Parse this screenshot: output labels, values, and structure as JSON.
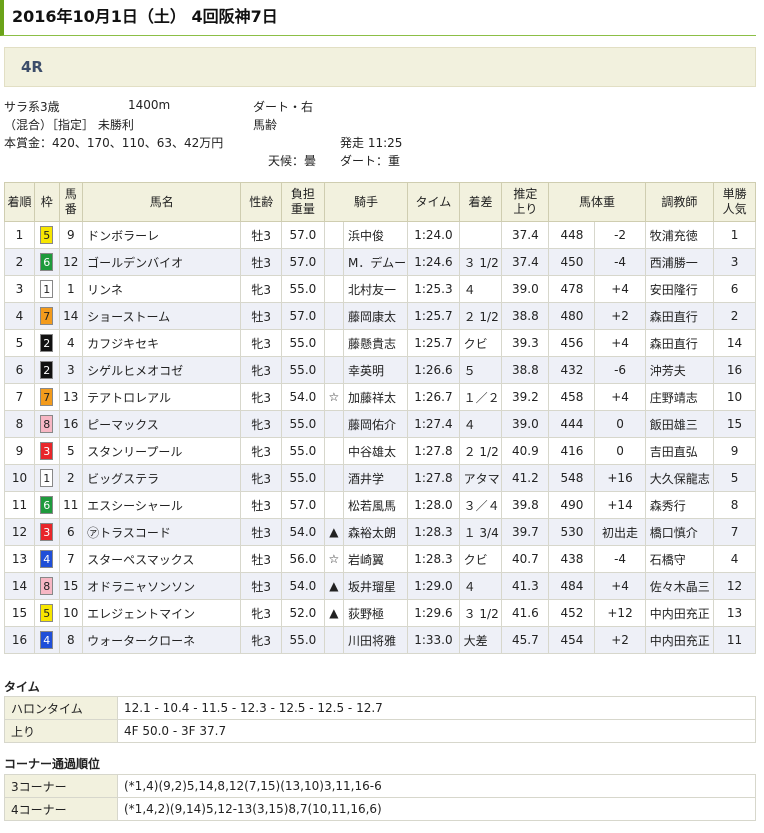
{
  "header": {
    "title": "2016年10月1日（土） 4回阪神7日"
  },
  "race": {
    "name": "4R"
  },
  "conditions": {
    "class": "サラ系3歳",
    "distance": "1400m",
    "track": "ダート・右",
    "type": "（混合）［指定］ 未勝利",
    "weight_rule": "馬齢",
    "prize": "本賞金：420、170、110、63、42万円",
    "start": "発走 11:25",
    "weather": "天候：曇",
    "going": "ダート：重"
  },
  "table": {
    "headers": [
      "着順",
      "枠",
      "馬番",
      "馬名",
      "性齢",
      "負担重量",
      "騎手",
      "タイム",
      "着差",
      "推定上り",
      "馬体重",
      "",
      "調教師",
      "単勝人気"
    ],
    "rows": [
      {
        "pos": "1",
        "waku": "5",
        "num": "9",
        "horse": "ドンボラーレ",
        "sex": "牡3",
        "wt": "57.0",
        "mark": "",
        "jockey": "浜中俊",
        "time": "1:24.0",
        "margin": "",
        "last": "37.4",
        "bw": "448",
        "diff": "-2",
        "trainer": "牧浦充徳",
        "pop": "1"
      },
      {
        "pos": "2",
        "waku": "6",
        "num": "12",
        "horse": "ゴールデンバイオ",
        "sex": "牡3",
        "wt": "57.0",
        "mark": "",
        "jockey": "M．デムーロ",
        "time": "1:24.6",
        "margin": "３ 1/2",
        "last": "37.4",
        "bw": "450",
        "diff": "-4",
        "trainer": "西浦勝一",
        "pop": "3"
      },
      {
        "pos": "3",
        "waku": "1",
        "num": "1",
        "horse": "リンネ",
        "sex": "牝3",
        "wt": "55.0",
        "mark": "",
        "jockey": "北村友一",
        "time": "1:25.3",
        "margin": "４",
        "last": "39.0",
        "bw": "478",
        "diff": "+4",
        "trainer": "安田隆行",
        "pop": "6"
      },
      {
        "pos": "4",
        "waku": "7",
        "num": "14",
        "horse": "ショーストーム",
        "sex": "牡3",
        "wt": "57.0",
        "mark": "",
        "jockey": "藤岡康太",
        "time": "1:25.7",
        "margin": "２ 1/2",
        "last": "38.8",
        "bw": "480",
        "diff": "+2",
        "trainer": "森田直行",
        "pop": "2"
      },
      {
        "pos": "5",
        "waku": "2",
        "num": "4",
        "horse": "カフジキセキ",
        "sex": "牝3",
        "wt": "55.0",
        "mark": "",
        "jockey": "藤懸貴志",
        "time": "1:25.7",
        "margin": "クビ",
        "last": "39.3",
        "bw": "456",
        "diff": "+4",
        "trainer": "森田直行",
        "pop": "14"
      },
      {
        "pos": "6",
        "waku": "2",
        "num": "3",
        "horse": "シゲルヒメオコゼ",
        "sex": "牝3",
        "wt": "55.0",
        "mark": "",
        "jockey": "幸英明",
        "time": "1:26.6",
        "margin": "５",
        "last": "38.8",
        "bw": "432",
        "diff": "-6",
        "trainer": "沖芳夫",
        "pop": "16"
      },
      {
        "pos": "7",
        "waku": "7",
        "num": "13",
        "horse": "テアトロレアル",
        "sex": "牝3",
        "wt": "54.0",
        "mark": "☆",
        "jockey": "加藤祥太",
        "time": "1:26.7",
        "margin": "１／２",
        "last": "39.2",
        "bw": "458",
        "diff": "+4",
        "trainer": "庄野靖志",
        "pop": "10"
      },
      {
        "pos": "8",
        "waku": "8",
        "num": "16",
        "horse": "ピーマックス",
        "sex": "牝3",
        "wt": "55.0",
        "mark": "",
        "jockey": "藤岡佑介",
        "time": "1:27.4",
        "margin": "４",
        "last": "39.0",
        "bw": "444",
        "diff": "0",
        "trainer": "飯田雄三",
        "pop": "15"
      },
      {
        "pos": "9",
        "waku": "3",
        "num": "5",
        "horse": "スタンリープール",
        "sex": "牝3",
        "wt": "55.0",
        "mark": "",
        "jockey": "中谷雄太",
        "time": "1:27.8",
        "margin": "２ 1/2",
        "last": "40.9",
        "bw": "416",
        "diff": "0",
        "trainer": "吉田直弘",
        "pop": "9"
      },
      {
        "pos": "10",
        "waku": "1",
        "num": "2",
        "horse": "ビッグステラ",
        "sex": "牝3",
        "wt": "55.0",
        "mark": "",
        "jockey": "酒井学",
        "time": "1:27.8",
        "margin": "アタマ",
        "last": "41.2",
        "bw": "548",
        "diff": "+16",
        "trainer": "大久保龍志",
        "pop": "5"
      },
      {
        "pos": "11",
        "waku": "6",
        "num": "11",
        "horse": "エスシーシャール",
        "sex": "牡3",
        "wt": "57.0",
        "mark": "",
        "jockey": "松若風馬",
        "time": "1:28.0",
        "margin": "３／４",
        "last": "39.8",
        "bw": "490",
        "diff": "+14",
        "trainer": "森秀行",
        "pop": "8"
      },
      {
        "pos": "12",
        "waku": "3",
        "num": "6",
        "horse": "㋐トラスコード",
        "sex": "牡3",
        "wt": "54.0",
        "mark": "▲",
        "jockey": "森裕太朗",
        "time": "1:28.3",
        "margin": "１ 3/4",
        "last": "39.7",
        "bw": "530",
        "diff": "初出走",
        "trainer": "橋口慎介",
        "pop": "7"
      },
      {
        "pos": "13",
        "waku": "4",
        "num": "7",
        "horse": "スターペスマックス",
        "sex": "牡3",
        "wt": "56.0",
        "mark": "☆",
        "jockey": "岩崎翼",
        "time": "1:28.3",
        "margin": "クビ",
        "last": "40.7",
        "bw": "438",
        "diff": "-4",
        "trainer": "石橋守",
        "pop": "4"
      },
      {
        "pos": "14",
        "waku": "8",
        "num": "15",
        "horse": "オドラニャソンソン",
        "sex": "牡3",
        "wt": "54.0",
        "mark": "▲",
        "jockey": "坂井瑠星",
        "time": "1:29.0",
        "margin": "４",
        "last": "41.3",
        "bw": "484",
        "diff": "+4",
        "trainer": "佐々木晶三",
        "pop": "12"
      },
      {
        "pos": "15",
        "waku": "5",
        "num": "10",
        "horse": "エレジェントマイン",
        "sex": "牝3",
        "wt": "52.0",
        "mark": "▲",
        "jockey": "荻野極",
        "time": "1:29.6",
        "margin": "３ 1/2",
        "last": "41.6",
        "bw": "452",
        "diff": "+12",
        "trainer": "中内田充正",
        "pop": "13"
      },
      {
        "pos": "16",
        "waku": "4",
        "num": "8",
        "horse": "ウォータークローネ",
        "sex": "牝3",
        "wt": "55.0",
        "mark": "",
        "jockey": "川田将雅",
        "time": "1:33.0",
        "margin": "大差",
        "last": "45.7",
        "bw": "454",
        "diff": "+2",
        "trainer": "中内田充正",
        "pop": "11"
      }
    ]
  },
  "waku_colors": {
    "1": {
      "bg": "#ffffff",
      "fg": "#222222"
    },
    "2": {
      "bg": "#111111",
      "fg": "#ffffff"
    },
    "3": {
      "bg": "#e8262a",
      "fg": "#ffffff"
    },
    "4": {
      "bg": "#1f4fd8",
      "fg": "#ffffff"
    },
    "5": {
      "bg": "#f7e600",
      "fg": "#222222"
    },
    "6": {
      "bg": "#1e9a3c",
      "fg": "#ffffff"
    },
    "7": {
      "bg": "#f39b1c",
      "fg": "#222222"
    },
    "8": {
      "bg": "#f7b7c4",
      "fg": "#222222"
    }
  },
  "time_section": {
    "title": "タイム",
    "furlong_label": "ハロンタイム",
    "furlong_value": "12.1 - 10.4 - 11.5 - 12.3 - 12.5 - 12.5 - 12.7",
    "last_label": "上り",
    "last_value": "4F 50.0 - 3F 37.7"
  },
  "corner_section": {
    "title": "コーナー通過順位",
    "c3_label": "3コーナー",
    "c3_value": "(*1,4)(9,2)5,14,8,12(7,15)(13,10)3,11,16-6",
    "c4_label": "4コーナー",
    "c4_value": "(*1,4,2)(9,14)5,12-13(3,15)8,7(10,11,16,6)"
  }
}
